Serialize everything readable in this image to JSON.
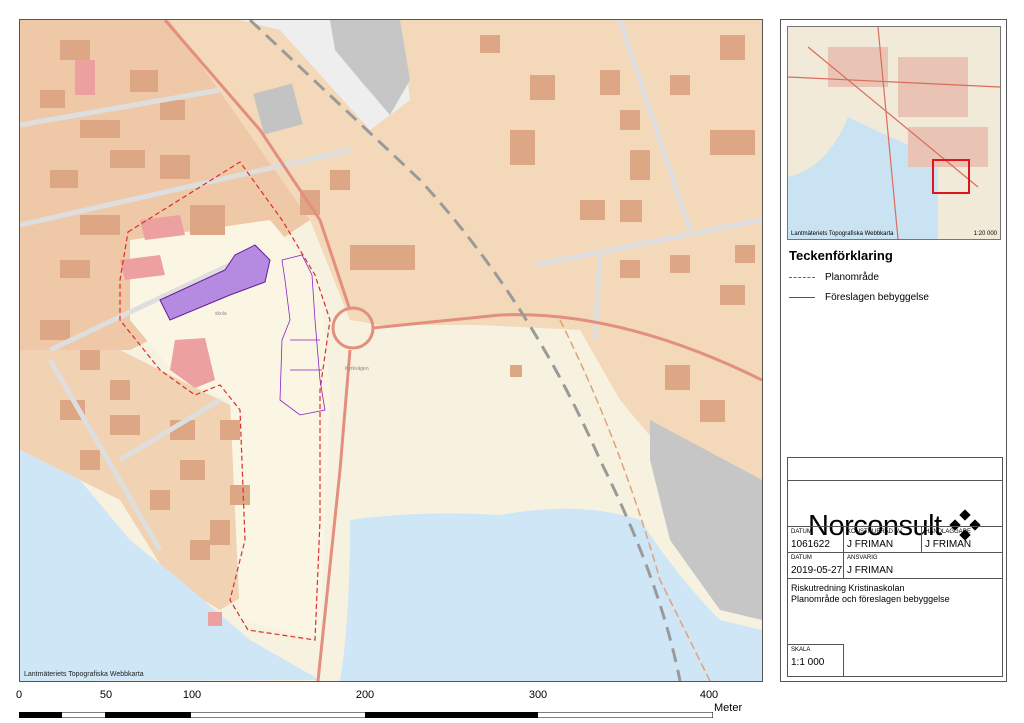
{
  "map": {
    "credit": "Lantmäteriets Topografiska Webbkarta"
  },
  "overview": {
    "credit": "Lantmäteriets Topografiska Webbkarta",
    "scale": "1:20 000",
    "highlight_color": "#e0141c"
  },
  "legend": {
    "title": "Teckenförklaring",
    "items": [
      {
        "label": "Planområde",
        "color": "#d9302a",
        "style": "dashed"
      },
      {
        "label": "Föreslagen bebyggelse",
        "color": "#8a22c9",
        "style": "solid"
      }
    ]
  },
  "title_block": {
    "company": "Norconsult",
    "datum_label": "DATUM",
    "datum_value": "1061622",
    "konstruerad_label": "KONSTRUERAD AV",
    "konstruerad_value": "J FRIMAN",
    "handlaggare_label": "HANDLAGGARE",
    "handlaggare_value": "J FRIMAN",
    "datum2_label": "DATUM",
    "datum2_value": "2019-05-27",
    "ansvarig_label": "ANSVARIG",
    "ansvarig_value": "J FRIMAN",
    "description_line1": "Riskutredning Kristinaskolan",
    "description_line2": "Planområde och föreslagen bebyggelse",
    "skala_label": "SKALA",
    "skala_value": "1:1 000"
  },
  "scalebar": {
    "ticks": [
      "0",
      "50",
      "100",
      "200",
      "300",
      "400"
    ],
    "unit": "Meter"
  },
  "colors": {
    "residential": "#f3d7b7",
    "residential_dark": "#efc6a7",
    "building": "#dca783",
    "water": "#cfe6f6",
    "road": "#e38f7d"
  }
}
